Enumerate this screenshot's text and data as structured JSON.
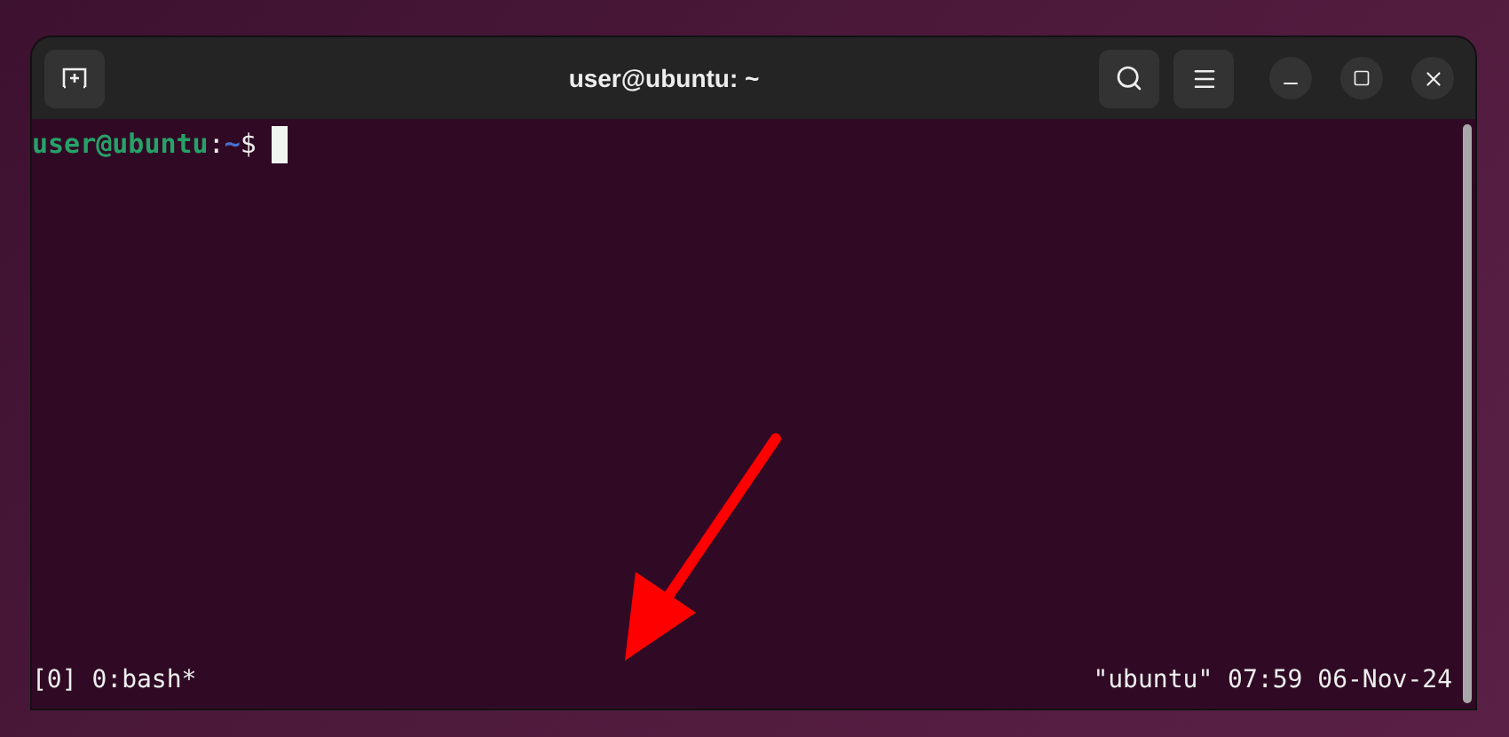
{
  "window": {
    "title": "user@ubuntu: ~"
  },
  "terminal": {
    "prompt": {
      "user_host": "user@ubuntu",
      "separator": ":",
      "path": "~",
      "symbol": "$"
    },
    "status_bar": {
      "left": "[0] 0:bash*",
      "right": "\"ubuntu\" 07:59 06-Nov-24"
    }
  }
}
